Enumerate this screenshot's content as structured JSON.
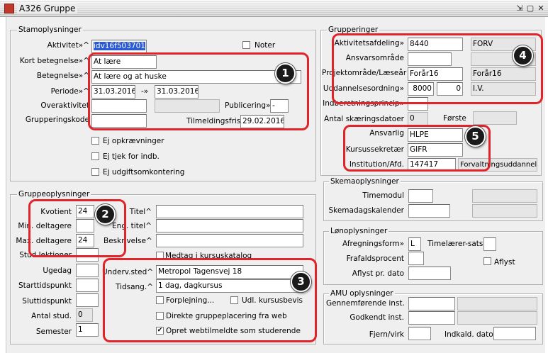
{
  "window": {
    "title": "A326 Gruppe"
  },
  "stamoplysninger": {
    "title": "Stamoplysninger",
    "aktivitet_label": "Aktivitet»^",
    "aktivitet_value": "idv16f503701",
    "noter_label": "Noter",
    "kort_label": "Kort betegnelse»^",
    "kort_value": "At lære",
    "betegnelse_label": "Betegnelse»^",
    "betegnelse_value": "At lære og at huske",
    "periode_label": "Periode»^",
    "periode_from": "31.03.2016",
    "periode_sep": "-»",
    "periode_to": "31.03.2016",
    "overaktivitet_label": "Overaktivitet",
    "publicering_label": "Publicering»",
    "publicering_value": "-",
    "grupperingskode_label": "Grupperingskode",
    "tilmeldingsfrist_label": "Tilmeldingsfrist",
    "tilmeldingsfrist_value": "29.02.2016",
    "ej_opkraevninger": "Ej opkrævninger",
    "ej_tjek": "Ej tjek for indb.",
    "ej_udgift": "Ej udgiftsomkontering"
  },
  "grupperinger": {
    "title": "Grupperinger",
    "aktivitetsafdeling_label": "Aktivitetsafdeling»",
    "aktivitetsafdeling_value": "8440",
    "aktivitetsafdeling_name": "FORV",
    "ansvarsomraade_label": "Ansvarsområde",
    "projekt_label": "Projektområde/Læseår",
    "projekt_value": "Forår16",
    "projekt_name": "Forår16",
    "uddannelse_label": "Uddannelsesordning»",
    "uddannelse_value1": "8000",
    "uddannelse_value2": "0",
    "uddannelse_name": "I.V.",
    "indberetning_label": "Indberetningsprincip»",
    "antal_label": "Antal skæringsdatoer",
    "antal_value": "0",
    "forste_label": "Første",
    "ansvarlig_label": "Ansvarlig",
    "ansvarlig_value": "HLPE",
    "kursussekretaer_label": "Kursussekretær",
    "kursussekretaer_value": "GIFR",
    "institution_label": "Institution/Afd.",
    "institution_value": "147417",
    "institution_name": "Forvaltningsuddannels"
  },
  "gruppeoplysninger": {
    "title": "Gruppeoplysninger",
    "kvotient_label": "Kvotient",
    "kvotient_value": "24",
    "min_label": "Min. deltagere",
    "max_label": "Max. deltagere",
    "max_value": "24",
    "stud_label": "Stud.lektioner",
    "titel_label": "Titel^",
    "eng_titel_label": "Eng. titel^",
    "beskrivelse_label": "Beskrivelse^",
    "medtag_label": "Medtag i kursuskatalog",
    "ugedag_label": "Ugedag",
    "starttid_label": "Starttidspunkt",
    "sluttid_label": "Sluttidspunkt",
    "antal_stud_label": "Antal stud.",
    "antal_stud_value": "0",
    "semester_label": "Semester",
    "semester_value": "1",
    "undervsted_label": "Underv.sted^",
    "undervsted_value": "Metropol Tagensvej 18",
    "tidsang_label": "Tidsang.^",
    "tidsang_value": "1 dag, dagkursus",
    "forplejning_label": "Forplejning...",
    "udl_label": "Udl. kursusbevis",
    "direkte_label": "Direkte gruppeplacering fra web",
    "opret_label": "Opret webtilmeldte som studerende"
  },
  "skemaoplysninger": {
    "title": "Skemaoplysninger",
    "timemodul_label": "Timemodul",
    "skemadag_label": "Skemadagskalender"
  },
  "lonoplysninger": {
    "title": "Lønoplysninger",
    "afregning_label": "Afregningsform»",
    "afregning_value": "L",
    "timelaerer_label": "Timelærer-sats",
    "frafald_label": "Frafaldsprocent",
    "aflyst_label": "Aflyst",
    "aflyst_dato_label": "Aflyst pr. dato"
  },
  "amu": {
    "title": "AMU oplysninger",
    "gennemforende_label": "Gennemførende inst.",
    "godkendt_label": "Godkendt inst.",
    "fjern_label": "Fjern/virk",
    "indkald_label": "Indkald. dato"
  },
  "callouts": [
    "1",
    "2",
    "3",
    "4",
    "5"
  ],
  "colors": {
    "callout": "#e0242a",
    "selection": "#2a5ad8",
    "badge": "#1a1a1a"
  }
}
